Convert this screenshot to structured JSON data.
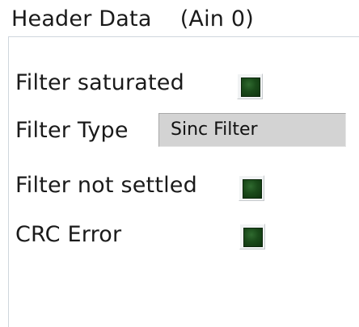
{
  "group": {
    "title": "Header Data    (Ain 0)"
  },
  "indicators": {
    "filter_saturated": {
      "label": "Filter saturated",
      "state": "off",
      "color": "#1a4a1a"
    },
    "filter_not_settled": {
      "label": "Filter not settled",
      "state": "off",
      "color": "#1a4a1a"
    },
    "crc_error": {
      "label": "CRC Error",
      "state": "off",
      "color": "#1a4a1a"
    }
  },
  "filter_type": {
    "label": "Filter Type",
    "value": "Sinc Filter"
  }
}
